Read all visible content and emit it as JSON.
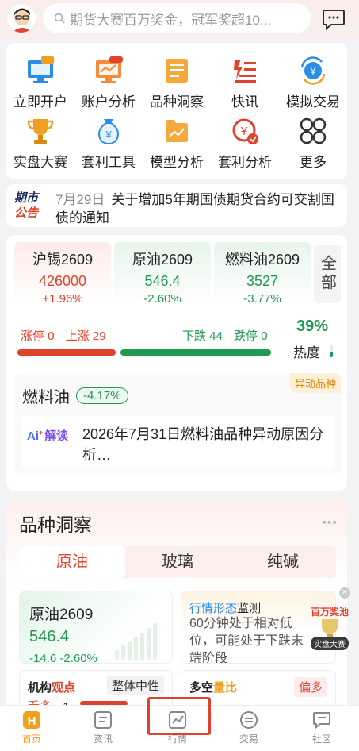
{
  "search": {
    "placeholder": "期货大赛百万奖金，冠军奖超10..."
  },
  "grid": [
    {
      "label": "立即开户",
      "icon": "open-account-icon",
      "badge": "期货"
    },
    {
      "label": "账户分析",
      "icon": "account-analysis-icon",
      "badge": "NEW"
    },
    {
      "label": "品种洞察",
      "icon": "variety-insight-icon"
    },
    {
      "label": "快讯",
      "icon": "news-flash-icon"
    },
    {
      "label": "模拟交易",
      "icon": "simulated-trade-icon"
    },
    {
      "label": "实盘大赛",
      "icon": "trophy-icon"
    },
    {
      "label": "套利工具",
      "icon": "arbitrage-tool-icon"
    },
    {
      "label": "模型分析",
      "icon": "model-analysis-icon"
    },
    {
      "label": "套利分析",
      "icon": "arbitrage-analysis-icon"
    },
    {
      "label": "更多",
      "icon": "more-icon"
    }
  ],
  "notice": {
    "logo_top": "期市",
    "logo_bottom": "公告",
    "date": "7月29日",
    "text": "关于增加5年期国债期货合约可交割国债的通知"
  },
  "quotes": [
    {
      "name": "沪锡2609",
      "price": "426000",
      "change": "+1.96%",
      "dir": "up"
    },
    {
      "name": "原油2609",
      "price": "546.4",
      "change": "-2.60%",
      "dir": "down"
    },
    {
      "name": "燃料油2609",
      "price": "3527",
      "change": "-3.77%",
      "dir": "down"
    }
  ],
  "all_label": "全部",
  "breadth": {
    "limit_up": "涨停 0",
    "up": "上涨 29",
    "down": "下跌 44",
    "limit_down": "跌停 0",
    "heat_value": "39%",
    "heat_label": "热度",
    "up_ratio": 0.395
  },
  "movement": {
    "name": "燃料油",
    "change": "-4.17%",
    "tag": "异动品种",
    "ai_label": "解读",
    "text": "2026年7月31日燃料油品种异动原因分析…"
  },
  "insight": {
    "title": "品种洞察",
    "tabs": [
      "原油",
      "玻璃",
      "纯碱"
    ],
    "active_tab": 0,
    "card1": {
      "name": "原油2609",
      "price": "546.4",
      "change": "-14.6 -2.60%"
    },
    "card2": {
      "title_a": "行情形态",
      "title_b": "监测",
      "text": "60分钟处于相对低位，可能处于下跌末端阶段"
    },
    "card3": {
      "title_a": "机构",
      "title_b": "观点",
      "badge": "整体中性",
      "left": "看多",
      "count": "1"
    },
    "card4": {
      "title_a": "多空",
      "title_b": "量比",
      "badge": "偏多"
    },
    "promo": {
      "top": "百万奖池",
      "bottom": "实盘大赛"
    }
  },
  "tabbar": [
    {
      "label": "首页",
      "icon": "home-icon",
      "active": true
    },
    {
      "label": "资讯",
      "icon": "news-icon"
    },
    {
      "label": "行情",
      "icon": "market-icon"
    },
    {
      "label": "交易",
      "icon": "trade-icon"
    },
    {
      "label": "社区",
      "icon": "community-icon"
    }
  ],
  "colors": {
    "accent": "#e0432c",
    "down": "#1f9a50",
    "highlight_box": "#e0432c",
    "active_tab": "#f0a020"
  }
}
